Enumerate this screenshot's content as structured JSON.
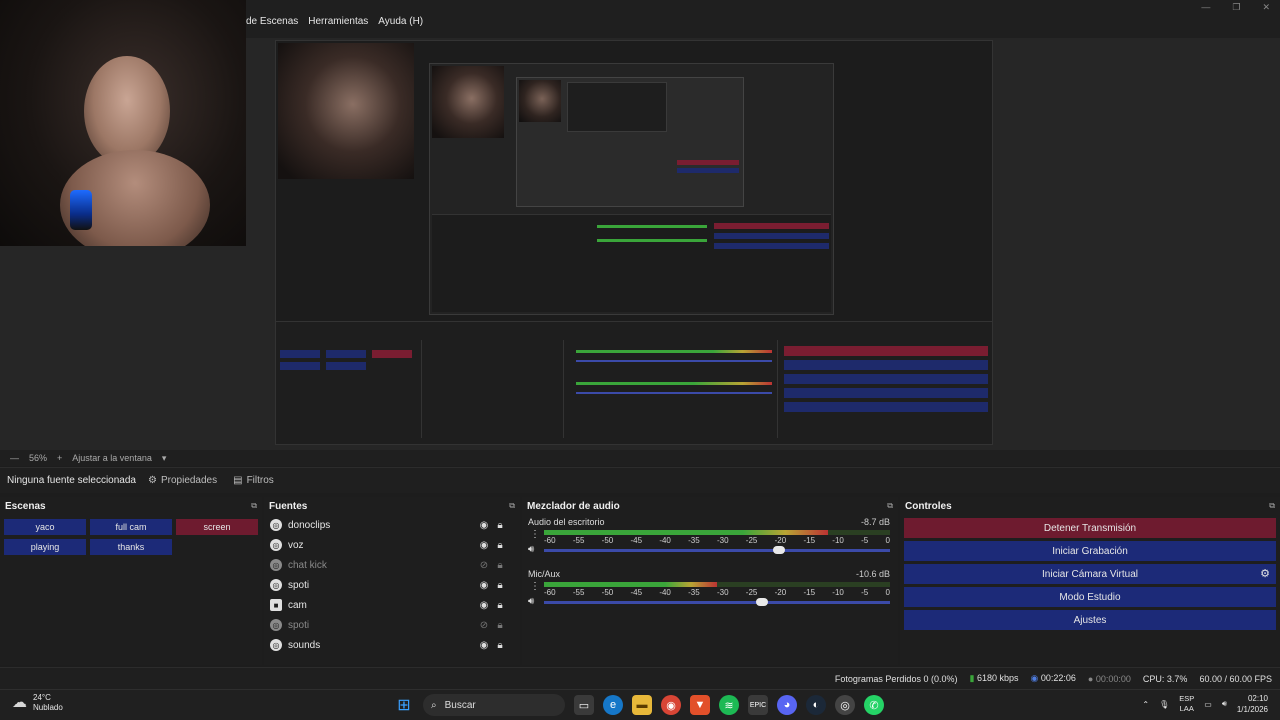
{
  "menu": {
    "items": [
      "de Escenas",
      "Herramientas",
      "Ayuda (H)"
    ]
  },
  "window_controls": {
    "minimize": "—",
    "maximize": "❐",
    "close": "✕"
  },
  "zoom": {
    "level": "56%",
    "fit_label": "Ajustar a la ventana",
    "dropdown": "▾"
  },
  "toolbar": {
    "no_source": "Ninguna fuente seleccionada",
    "properties": "Propiedades",
    "filters": "Filtros"
  },
  "scenes": {
    "title": "Escenas",
    "items": [
      {
        "label": "yaco",
        "active": false
      },
      {
        "label": "full cam",
        "active": false
      },
      {
        "label": "screen",
        "active": true
      },
      {
        "label": "playing",
        "active": false
      },
      {
        "label": "thanks",
        "active": false
      }
    ]
  },
  "sources": {
    "title": "Fuentes",
    "items": [
      {
        "label": "donoclips",
        "visible": true,
        "icon": "globe-icon"
      },
      {
        "label": "voz",
        "visible": true,
        "icon": "globe-icon"
      },
      {
        "label": "chat kick",
        "visible": false,
        "icon": "globe-icon"
      },
      {
        "label": "spoti",
        "visible": true,
        "icon": "globe-icon"
      },
      {
        "label": "cam",
        "visible": true,
        "icon": "camera-icon"
      },
      {
        "label": "spoti",
        "visible": false,
        "icon": "globe-icon"
      },
      {
        "label": "sounds",
        "visible": true,
        "icon": "globe-icon"
      }
    ]
  },
  "mixer": {
    "title": "Mezclador de audio",
    "scale": [
      "-60",
      "-55",
      "-50",
      "-45",
      "-40",
      "-35",
      "-30",
      "-25",
      "-20",
      "-15",
      "-10",
      "-5",
      "0"
    ],
    "channels": [
      {
        "name": "Audio del escritorio",
        "db": "-8.7 dB",
        "level": 0.82,
        "volume": 0.68
      },
      {
        "name": "Mic/Aux",
        "db": "-10.6 dB",
        "level": 0.5,
        "volume": 0.63
      }
    ]
  },
  "controls": {
    "title": "Controles",
    "buttons": [
      {
        "label": "Detener Transmisión",
        "style": "red"
      },
      {
        "label": "Iniciar Grabación",
        "style": "blue"
      },
      {
        "label": "Iniciar Cámara Virtual",
        "style": "blue"
      },
      {
        "label": "Modo Estudio",
        "style": "blue"
      },
      {
        "label": "Ajustes",
        "style": "blue"
      }
    ]
  },
  "status": {
    "dropped_frames": "Fotogramas Perdidos 0 (0.0%)",
    "bitrate": "6180 kbps",
    "stream_time": "00:22:06",
    "rec_time": "00:00:00",
    "cpu": "CPU: 3.7%",
    "fps": "60.00 / 60.00 FPS"
  },
  "taskbar": {
    "weather_temp": "24°C",
    "weather_desc": "Nublado",
    "search_label": "Buscar",
    "lang_top": "ESP",
    "lang_bottom": "LAA",
    "time": "02:10",
    "date": "1/1/2026"
  },
  "colors": {
    "scene_button": "#1c2a78",
    "scene_active": "#6e1b2f",
    "stop_stream": "#6e1b2f",
    "control_button": "#1c2a78"
  }
}
